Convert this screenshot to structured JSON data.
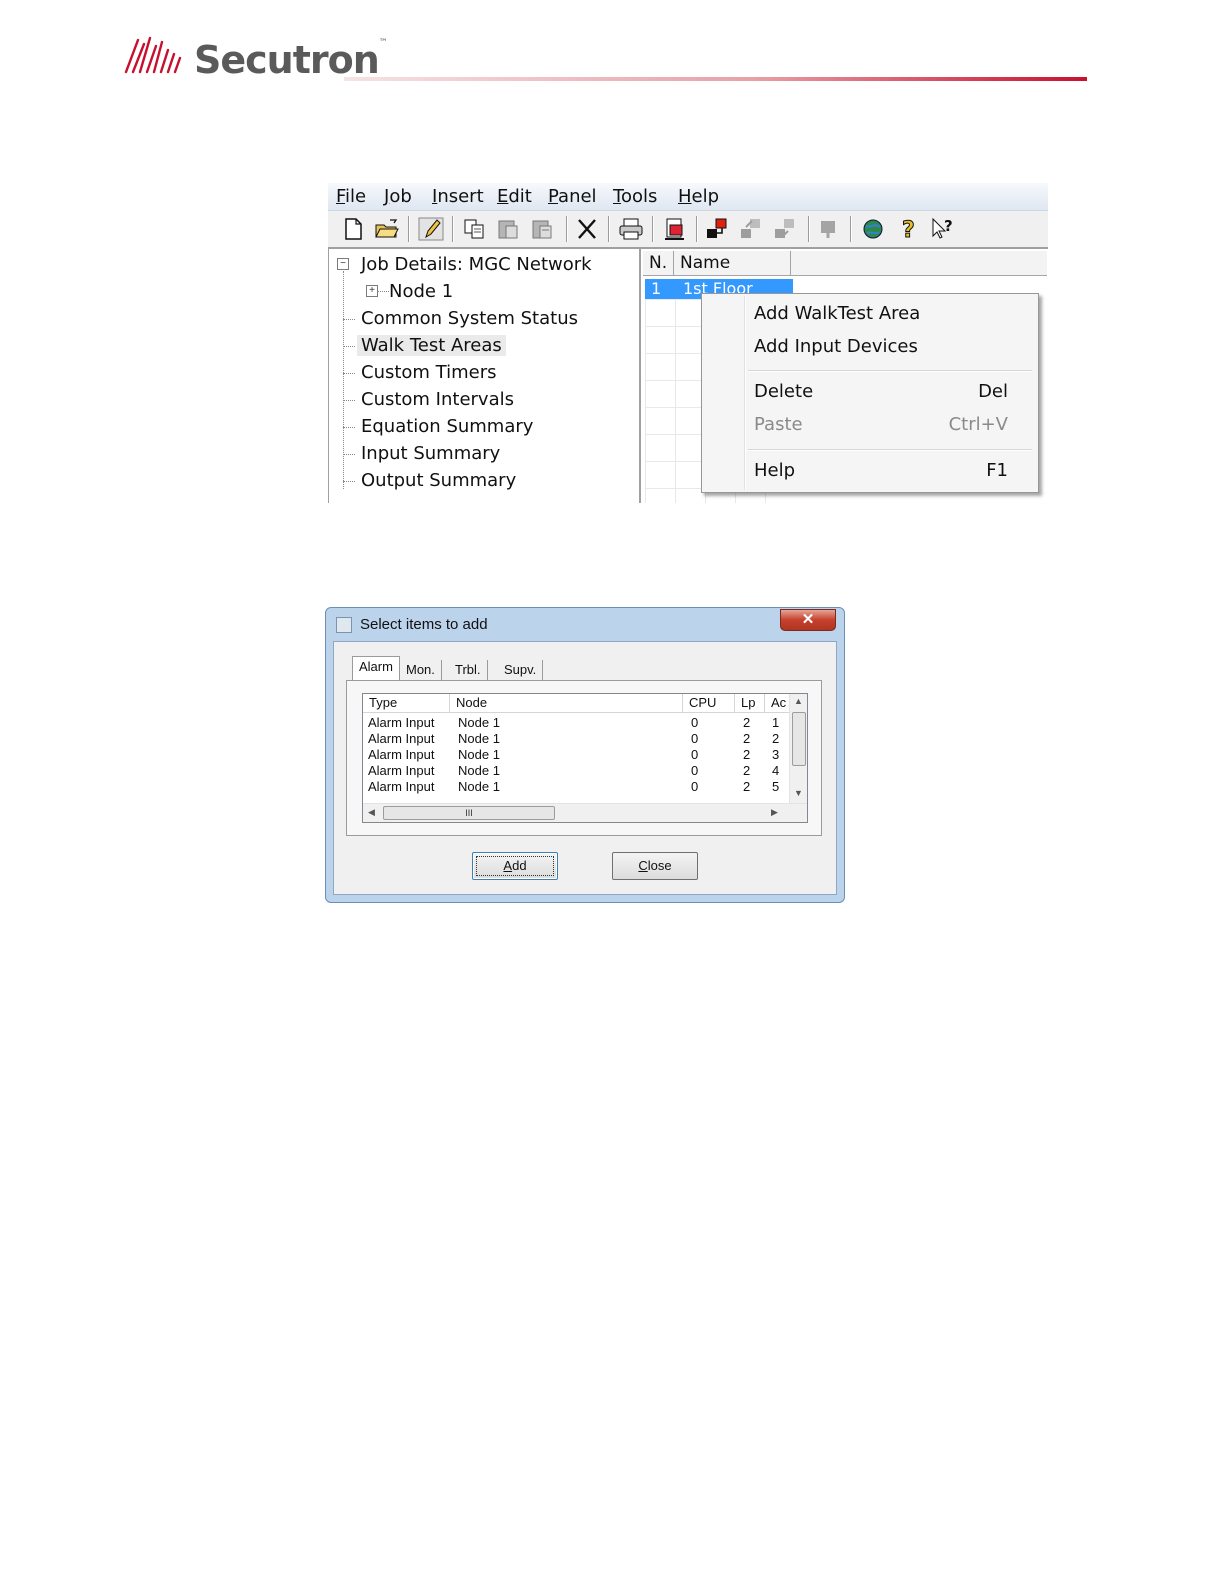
{
  "brand": {
    "name": "Secutron",
    "trademark": "™"
  },
  "main_window": {
    "menu": [
      {
        "label": "File",
        "accel": "F",
        "rest": "ile"
      },
      {
        "label": "Job",
        "accel": "J",
        "rest": "ob"
      },
      {
        "label": "Insert",
        "accel": "I",
        "rest": "nsert"
      },
      {
        "label": "Edit",
        "accel": "E",
        "rest": "dit"
      },
      {
        "label": "Panel",
        "accel": "P",
        "rest": "anel"
      },
      {
        "label": "Tools",
        "accel": "T",
        "rest": "ools"
      },
      {
        "label": "Help",
        "accel": "H",
        "rest": "elp"
      }
    ],
    "toolbar_icons": [
      "new-document-icon",
      "open-folder-icon",
      "edit-pencil-icon",
      "copy-icon",
      "paste-icon",
      "paste-special-icon",
      "delete-x-icon",
      "print-icon",
      "print-preview-icon",
      "network-node-icon",
      "transfer-up-icon",
      "transfer-down-icon",
      "export-icon",
      "globe-icon",
      "help-question-icon",
      "context-help-icon"
    ],
    "tree": {
      "root": "Job Details: MGC Network",
      "node": "Node 1",
      "items": [
        "Common System Status",
        "Walk Test Areas",
        "Custom Timers",
        "Custom Intervals",
        "Equation Summary",
        "Input Summary",
        "Output Summary"
      ],
      "selected": "Walk Test Areas"
    },
    "grid": {
      "columns": [
        "N.",
        "Name"
      ],
      "selected_row": {
        "n": "1",
        "name": "1st Floor"
      }
    },
    "context_menu": {
      "items": [
        {
          "label": "Add WalkTest Area",
          "shortcut": ""
        },
        {
          "label": "Add Input Devices",
          "shortcut": ""
        },
        {
          "label": "Delete",
          "shortcut": "Del"
        },
        {
          "label": "Paste",
          "shortcut": "Ctrl+V",
          "disabled": true
        },
        {
          "label": "Help",
          "shortcut": "F1"
        }
      ]
    }
  },
  "dialog": {
    "title": "Select items to add",
    "close_glyph": "✕",
    "tabs": [
      "Alarm",
      "Mon.",
      "Trbl.",
      "Supv."
    ],
    "active_tab": "Alarm",
    "columns": [
      "Type",
      "Node",
      "CPU",
      "Lp",
      "Ac"
    ],
    "rows": [
      {
        "type": "Alarm Input",
        "node": "Node 1",
        "cpu": "0",
        "lp": "2",
        "ac": "1"
      },
      {
        "type": "Alarm Input",
        "node": "Node 1",
        "cpu": "0",
        "lp": "2",
        "ac": "2"
      },
      {
        "type": "Alarm Input",
        "node": "Node 1",
        "cpu": "0",
        "lp": "2",
        "ac": "3"
      },
      {
        "type": "Alarm Input",
        "node": "Node 1",
        "cpu": "0",
        "lp": "2",
        "ac": "4"
      },
      {
        "type": "Alarm Input",
        "node": "Node 1",
        "cpu": "0",
        "lp": "2",
        "ac": "5"
      }
    ],
    "scroll_thumb_glyph": "III",
    "buttons": {
      "add": {
        "accel": "A",
        "rest": "dd"
      },
      "close": {
        "accel": "C",
        "rest": "lose"
      }
    }
  }
}
